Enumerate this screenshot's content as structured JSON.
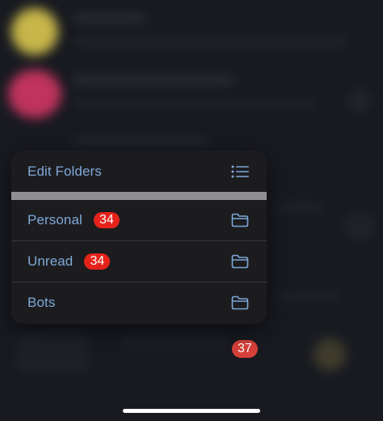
{
  "menu": {
    "header": {
      "label": "Edit Folders",
      "icon": "list-icon"
    },
    "items": [
      {
        "label": "Personal",
        "badge": "34",
        "icon": "folder-icon"
      },
      {
        "label": "Unread",
        "badge": "34",
        "icon": "folder-icon"
      },
      {
        "label": "Bots",
        "badge": "",
        "icon": "folder-icon"
      }
    ]
  },
  "background": {
    "unread_badge": "37"
  },
  "colors": {
    "menu_text": "#7fa8d8",
    "badge": "#e5231b",
    "menu_bg": "#1c1c1f",
    "page_bg": "#181a20"
  }
}
